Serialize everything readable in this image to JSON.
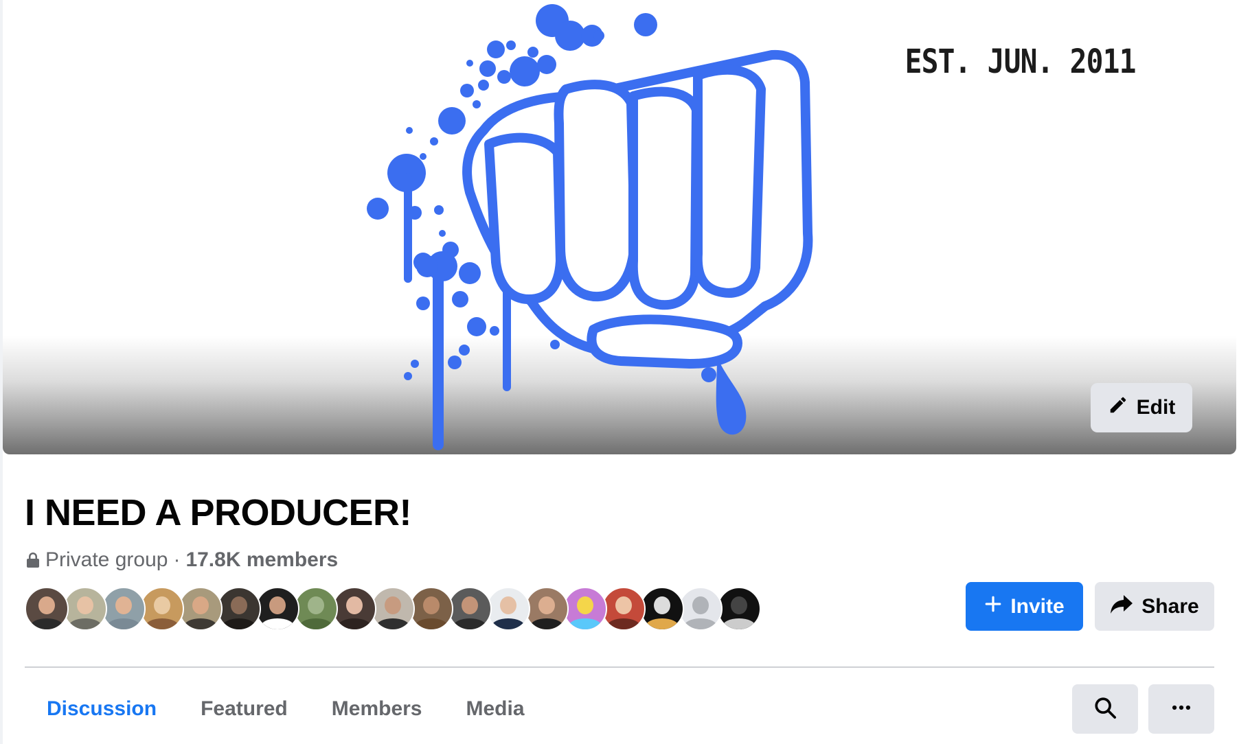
{
  "cover": {
    "tagline": "EST. JUN. 2011",
    "edit_label": "Edit"
  },
  "group": {
    "name": "I NEED A PRODUCER!",
    "privacy": "Private group",
    "separator": "·",
    "members": "17.8K members"
  },
  "member_avatars": [
    {
      "bg": "#5a4a42",
      "face": "#d9a98b",
      "body": "#2b2b2b"
    },
    {
      "bg": "#b7b49c",
      "face": "#e7c2a5",
      "body": "#6d6d64"
    },
    {
      "bg": "#8fa0a8",
      "face": "#e0b394",
      "body": "#7a8a95"
    },
    {
      "bg": "#c79a5e",
      "face": "#e9caa3",
      "body": "#8b5e3a"
    },
    {
      "bg": "#a89a7c",
      "face": "#d9a886",
      "body": "#3e3a34"
    },
    {
      "bg": "#3b3631",
      "face": "#8a6b57",
      "body": "#1e1b18"
    },
    {
      "bg": "#1f1f1f",
      "face": "#c89a7e",
      "body": "#ffffff"
    },
    {
      "bg": "#6f8a55",
      "face": "#9fb48a",
      "body": "#4f6a3a"
    },
    {
      "bg": "#4a3b36",
      "face": "#e2b9a3",
      "body": "#2d2320"
    },
    {
      "bg": "#c0b8ad",
      "face": "#c79b80",
      "body": "#2f2f2f"
    },
    {
      "bg": "#7c6148",
      "face": "#b98a6a",
      "body": "#6a4b2e"
    },
    {
      "bg": "#5b5b5b",
      "face": "#c39478",
      "body": "#2a2a2a"
    },
    {
      "bg": "#e9ecef",
      "face": "#e5c0a5",
      "body": "#1f2f4a"
    },
    {
      "bg": "#9a7a64",
      "face": "#dcae90",
      "body": "#1f1f1f"
    },
    {
      "bg": "#c77bd6",
      "face": "#f4d64a",
      "body": "#5ac8fa"
    },
    {
      "bg": "#c44a3a",
      "face": "#edc4a6",
      "body": "#6d2a20"
    },
    {
      "bg": "#111111",
      "face": "#dcdcdc",
      "body": "#e0a84a"
    },
    {
      "bg": "#e4e6eb",
      "face": "#b0b3b8",
      "body": "#b0b3b8"
    },
    {
      "bg": "#111111",
      "face": "#444444",
      "body": "#cccccc"
    }
  ],
  "actions": {
    "invite_label": "Invite",
    "share_label": "Share"
  },
  "tabs": [
    {
      "label": "Discussion",
      "active": true
    },
    {
      "label": "Featured",
      "active": false
    },
    {
      "label": "Members",
      "active": false
    },
    {
      "label": "Media",
      "active": false
    }
  ],
  "icons": {
    "search": "search-icon",
    "more": "more-icon",
    "edit": "pencil-icon",
    "invite": "plus-icon",
    "share": "share-arrow-icon",
    "privacy": "lock-icon"
  },
  "colors": {
    "accent": "#1877f2",
    "fist_blue": "#3b6ef0",
    "button_gray": "#e4e6eb",
    "secondary_text": "#65676b"
  }
}
